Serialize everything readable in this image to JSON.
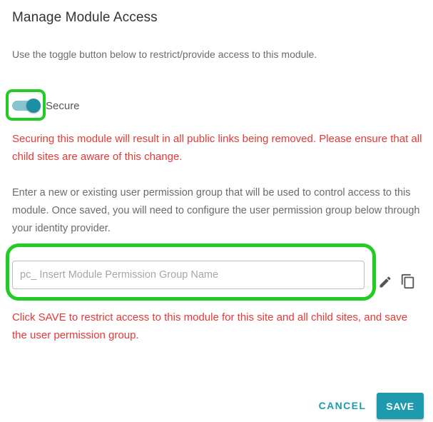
{
  "dialog": {
    "title": "Manage Module Access",
    "intro": "Use the toggle button below to restrict/provide access to this module."
  },
  "secure_toggle": {
    "label": "Secure",
    "state": "on"
  },
  "warnings": {
    "public_links": "Securing this module will result in all public links being removed. Please ensure that all child sites are aware of this change.",
    "save_notice": "Click SAVE to restrict access to this module for this site and all child sites, and save the user permission group."
  },
  "instructions": "Enter a new or existing user permission group that will be used to control access to this module. Once saved, you will need to configure the user permission group below through your identity provider.",
  "permission_group": {
    "value": "",
    "placeholder": "pc_ Insert Module Permission Group Name"
  },
  "icons": {
    "edit": "pencil-icon",
    "copy": "copy-icon"
  },
  "footer": {
    "cancel_label": "CANCEL",
    "save_label": "SAVE"
  },
  "colors": {
    "accent": "#1e9aaf",
    "warning": "#e53935",
    "highlight": "#22cc22"
  }
}
